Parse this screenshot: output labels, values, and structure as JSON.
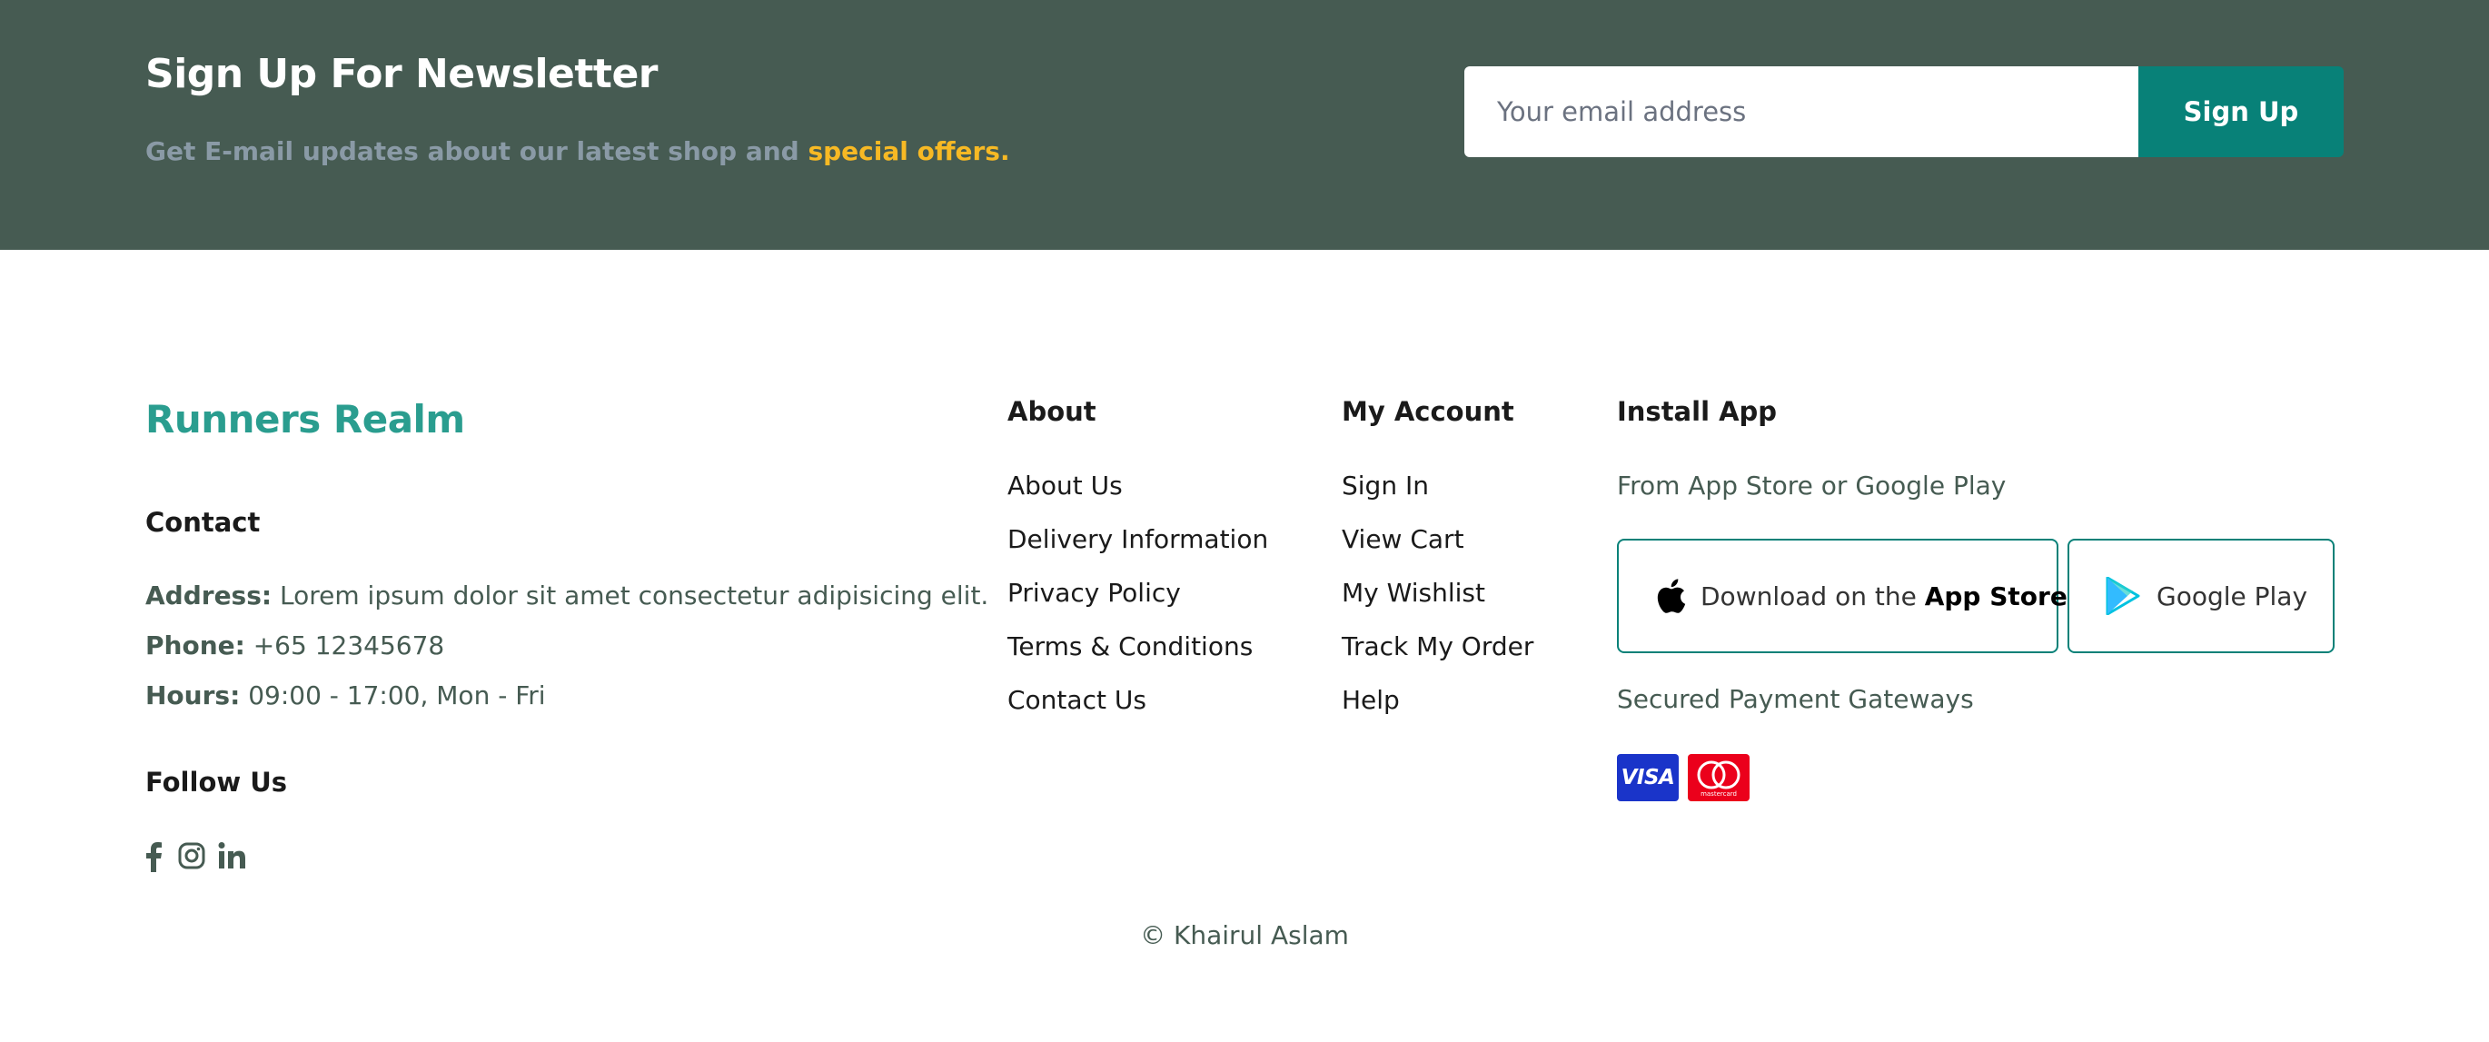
{
  "newsletter": {
    "title": "Sign Up For Newsletter",
    "subtitle_prefix": "Get E-mail updates about our latest shop and ",
    "subtitle_highlight": "special offers.",
    "email_placeholder": "Your email address",
    "email_value": "",
    "button_label": "Sign Up"
  },
  "brand": {
    "name": "Runners Realm"
  },
  "contact": {
    "heading": "Contact",
    "address_label": "Address:",
    "address_value": "Lorem ipsum dolor sit amet consectetur adipisicing elit.",
    "phone_label": "Phone:",
    "phone_value": "+65 12345678",
    "hours_label": "Hours:",
    "hours_value": "09:00 - 17:00, Mon - Fri"
  },
  "follow": {
    "heading": "Follow Us",
    "icons": [
      "facebook-icon",
      "instagram-icon",
      "linkedin-icon"
    ]
  },
  "about": {
    "heading": "About",
    "links": [
      "About Us",
      "Delivery Information",
      "Privacy Policy",
      "Terms & Conditions",
      "Contact Us"
    ]
  },
  "account": {
    "heading": "My Account",
    "links": [
      "Sign In",
      "View Cart",
      "My Wishlist",
      "Track My Order",
      "Help"
    ]
  },
  "install": {
    "heading": "Install App",
    "subtitle": "From App Store or Google Play",
    "app_store_prefix": "Download on the ",
    "app_store_name": "App Store",
    "google_play": "Google Play",
    "payments_label": "Secured Payment Gateways",
    "visa_text": "VISA",
    "mastercard_text": "mastercard"
  },
  "footer": {
    "copyright": "© Khairul Aslam"
  },
  "colors": {
    "newsletter_bg": "#465b52",
    "accent_teal": "#088178",
    "brand_teal": "#2a9d8f",
    "highlight_yellow": "#f7b924",
    "visa_blue": "#1a34c9",
    "mastercard_red": "#eb001b"
  }
}
